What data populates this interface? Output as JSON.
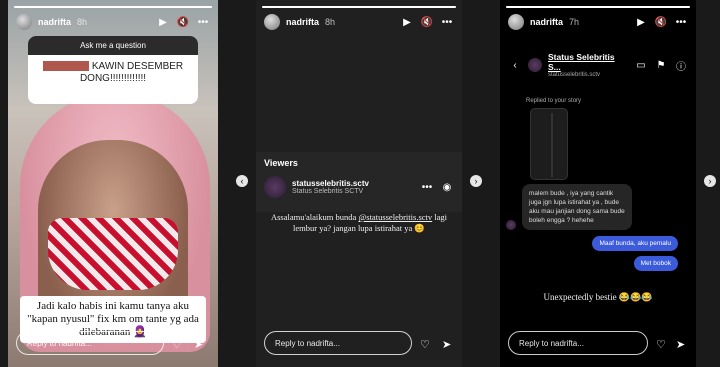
{
  "story1": {
    "username": "nadrifta",
    "time": "8h",
    "question_title": "Ask me a question",
    "question_text": "KAWIN DESEMBER DONG!!!!!!!!!!!!!",
    "caption": "Jadi kalo habis ini kamu tanya aku \"kapan nyusul\" fix km om tante yg ada dilebaranan 🧕",
    "reply_placeholder": "Reply to nadrifta..."
  },
  "story2": {
    "username": "nadrifta",
    "time": "8h",
    "viewers_title": "Viewers",
    "viewer_name": "statusselebritis.sctv",
    "viewer_sub": "Status Selebritis SCTV",
    "comment_prefix": "Assalamu'alaikum bunda ",
    "comment_mention": "@statusselebritis.sctv",
    "comment_suffix": " lagi lembur ya? jangan lupa istirahat ya 😊",
    "reply_placeholder": "Reply to nadrifta..."
  },
  "story3": {
    "username": "nadrifta",
    "time": "7h",
    "chat_name": "Status Selebritis S...",
    "chat_handle": "statusselebritis.sctv",
    "replied_label": "Replied to your story",
    "incoming_message": "malem bude , iya yang cantik juga jgn lupa istirahat ya , bude aku mau janjian dong sama bude boleh engga ? hehehe",
    "outgoing_1": "Maaf bunda, aku pemalu",
    "outgoing_2": "Met bobok",
    "tagline": "Unexpectedly bestie 😂😂😂",
    "reply_placeholder": "Reply to nadrifta..."
  },
  "icons": {
    "play": "▶",
    "mute": "🔇",
    "more": "•••",
    "heart": "♡",
    "send": "➤",
    "back": "‹",
    "next": "›"
  }
}
